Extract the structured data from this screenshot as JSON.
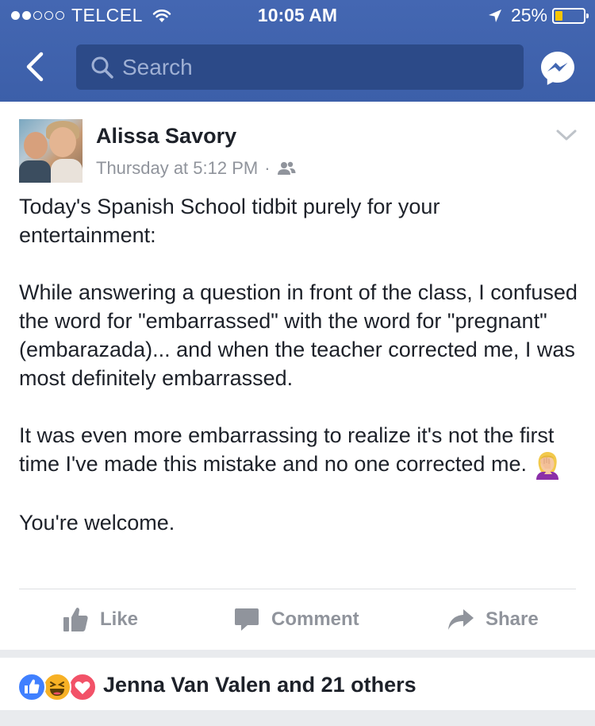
{
  "status_bar": {
    "carrier": "TELCEL",
    "time": "10:05 AM",
    "battery": "25%",
    "signal_bars_filled": 2,
    "signal_bars_total": 5,
    "battery_level": 0.25,
    "battery_color": "#f7c600"
  },
  "nav": {
    "back_icon": "chevron-left-icon",
    "search_placeholder": "Search",
    "messenger_icon": "messenger-icon",
    "bar_color": "#4267b2"
  },
  "post": {
    "author": "Alissa Savory",
    "timestamp": "Thursday at 5:12 PM",
    "separator": "·",
    "privacy_icon": "friends-icon",
    "options_icon": "chevron-down-icon",
    "paragraphs": [
      "Today's Spanish School tidbit purely for your entertainment:",
      "While answering a question in front of the class, I confused the word for \"embarrassed\" with the word for \"pregnant\" (embarazada)... and when the teacher corrected me, I was most definitely embarrassed.",
      "It was even more embarrassing to realize it's not the first time I've made this mistake and no one corrected me.",
      "You're welcome."
    ],
    "emoji": "facepalm-woman-emoji"
  },
  "actions": {
    "like": "Like",
    "comment": "Comment",
    "share": "Share"
  },
  "reactions": {
    "text": "Jenna Van Valen and 21 others",
    "types": [
      "like",
      "haha",
      "love"
    ]
  }
}
